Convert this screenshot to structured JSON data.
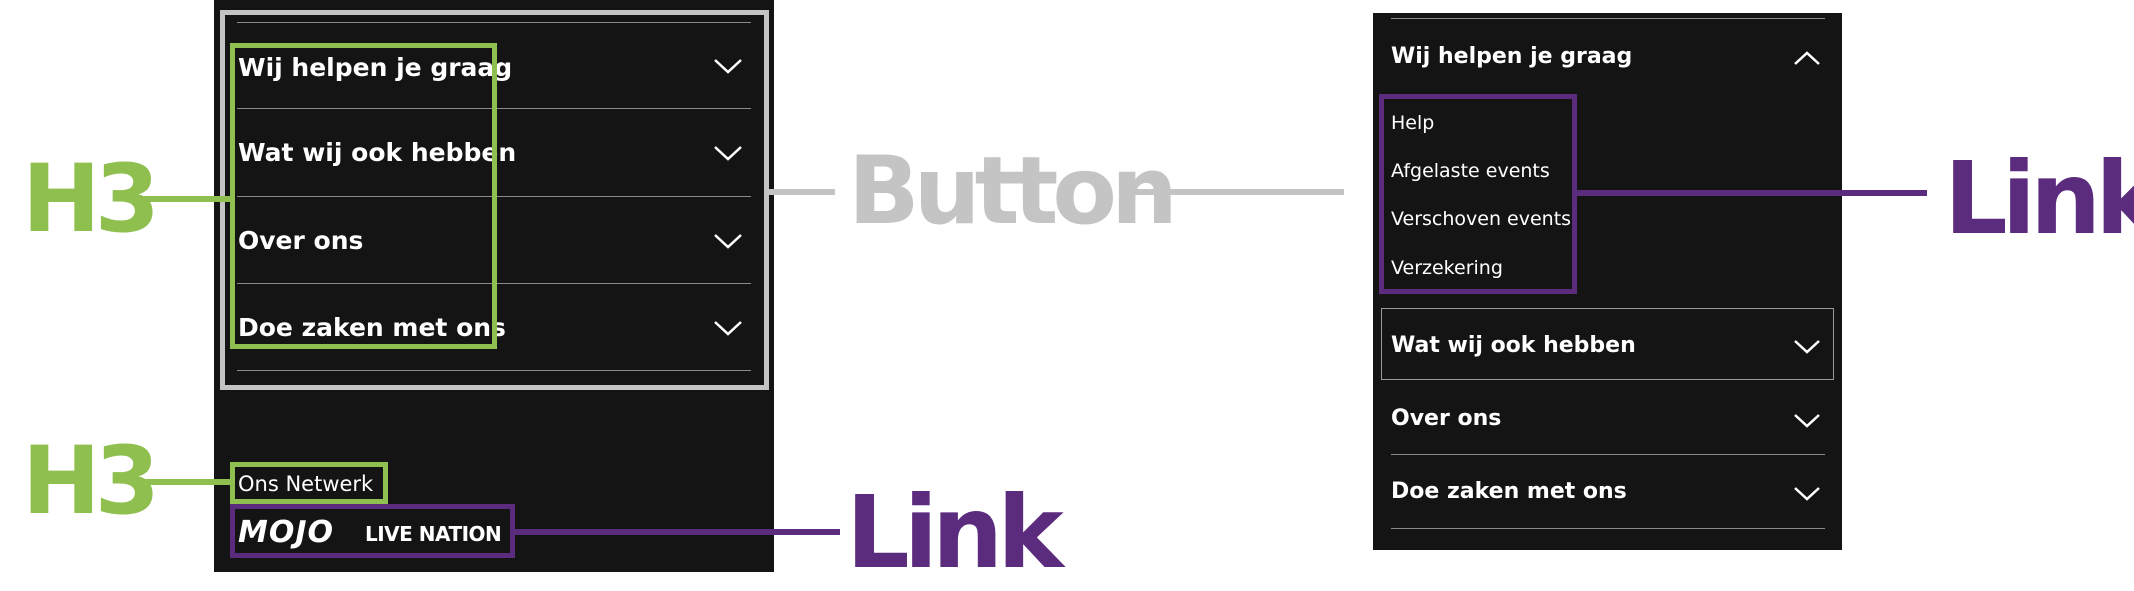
{
  "left_panel": {
    "accordion_items": [
      {
        "title": "Wij helpen je graag",
        "state": "collapsed"
      },
      {
        "title": "Wat wij ook hebben",
        "state": "collapsed"
      },
      {
        "title": "Over ons",
        "state": "collapsed"
      },
      {
        "title": "Doe zaken met ons",
        "state": "collapsed"
      }
    ],
    "network": {
      "title": "Ons Netwerk",
      "logos": [
        "MOJO",
        "LIVE NATION"
      ]
    }
  },
  "right_panel": {
    "expanded_item": {
      "title": "Wij helpen je graag",
      "state": "expanded",
      "links": [
        "Help",
        "Afgelaste events",
        "Verschoven events",
        "Verzekering"
      ]
    },
    "accordion_items": [
      {
        "title": "Wat wij ook hebben",
        "state": "collapsed"
      },
      {
        "title": "Over ons",
        "state": "collapsed"
      },
      {
        "title": "Doe zaken met ons",
        "state": "collapsed"
      }
    ]
  },
  "annotations": {
    "h3_label_top": "H3",
    "h3_label_bottom": "H3",
    "button_label": "Button",
    "link_label_right": "Link",
    "link_label_bottom": "Link"
  },
  "colors": {
    "panel_bg": "#141414",
    "h3_annotation": "#8fbf4e",
    "link_annotation": "#5b2c7e",
    "button_annotation": "#c4c4c4"
  },
  "icons": {
    "collapsed": "chevron-down-icon",
    "expanded": "chevron-up-icon"
  }
}
